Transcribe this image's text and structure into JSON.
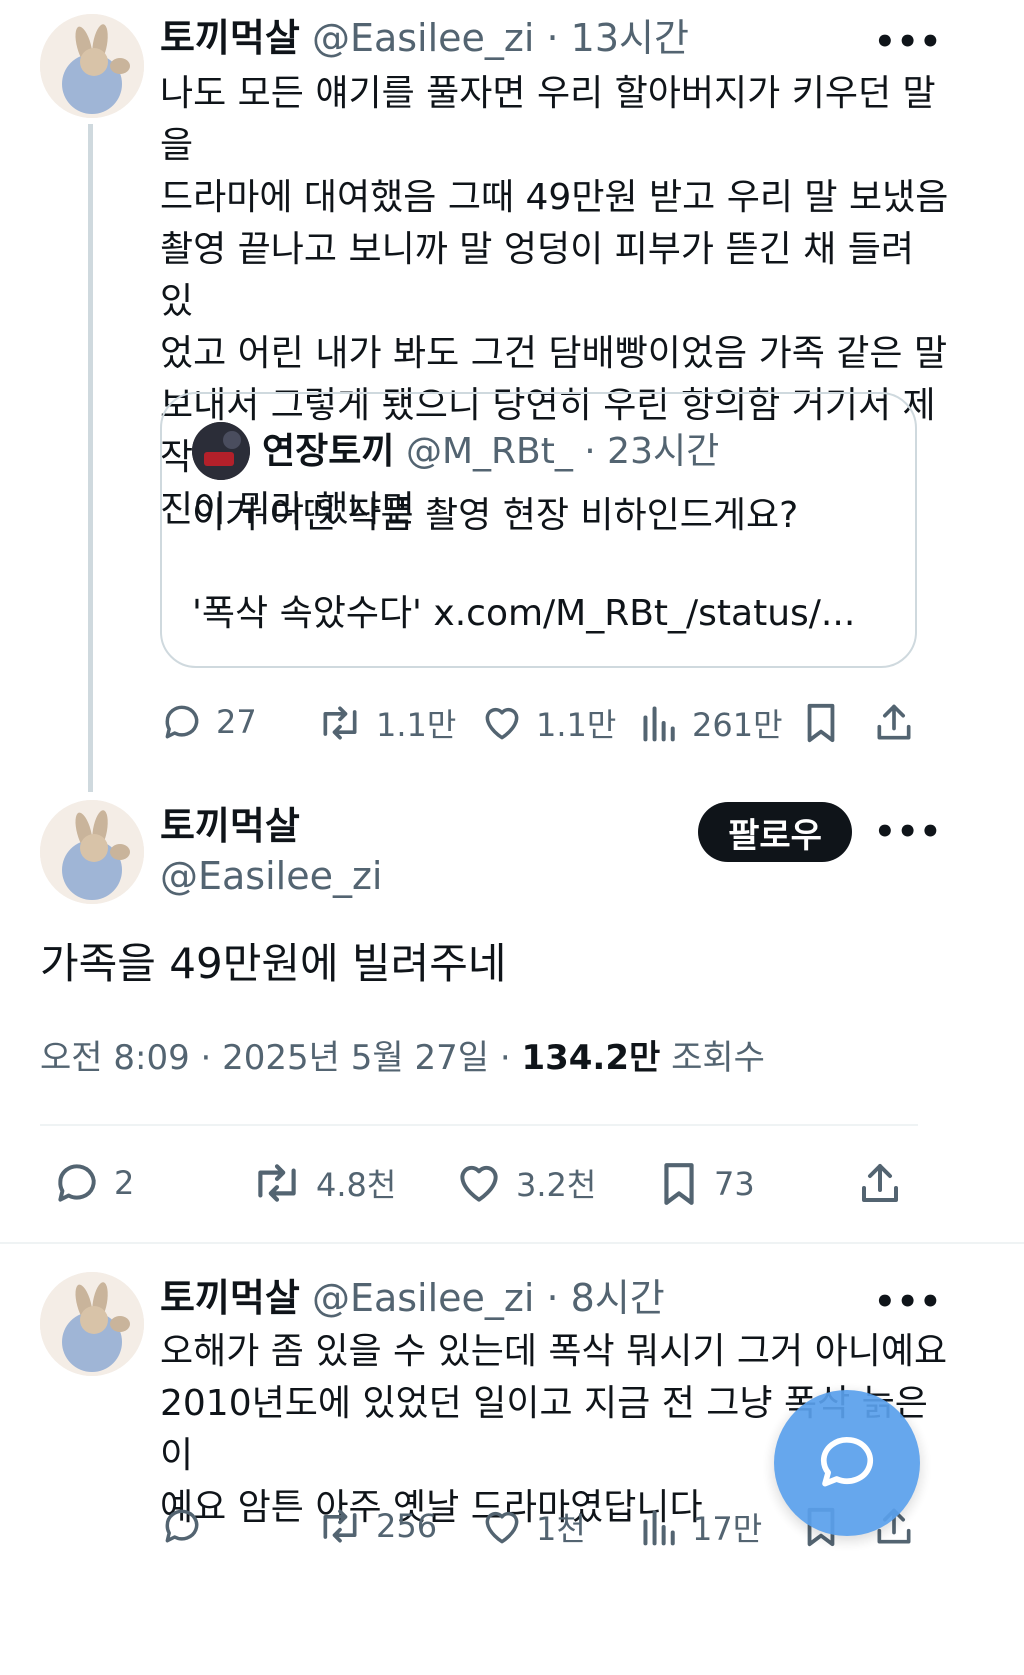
{
  "tweet1": {
    "display_name": "토끼먹살",
    "handle": "@Easilee_zi",
    "time": "· 13시간",
    "text": "나도 모든 얘기를 풀자면 우리 할아버지가 키우던 말을\n드라마에 대여했음 그때 49만원 받고 우리 말 보냈음\n촬영 끝나고 보니까 말 엉덩이 피부가 뜯긴 채 들려 있\n었고 어린 내가 봐도 그건 담배빵이었음 가족 같은 말\n보내서 그렇게 됐으니 당연히 우린 항의함 거기서 제작\n진이 뭐라 했냐면",
    "quote": {
      "display_name": "연장토끼",
      "handle": "@M_RBt_",
      "time": "· 23시간",
      "line1": "이거 어떤 작품 촬영 현장 비하인드게요?",
      "line2": "'폭삭 속았수다' x.com/M_RBt_/status/..."
    },
    "actions": {
      "replies": "27",
      "retweets": "1.1만",
      "likes": "1.1만",
      "views": "261만"
    }
  },
  "main": {
    "display_name": "토끼먹살",
    "handle": "@Easilee_zi",
    "follow_label": "팔로우",
    "text": "가족을 49만원에 빌려주네",
    "timestamp": "오전 8:09 · 2025년 5월 27일 · ",
    "views_count": "134.2만",
    "views_label": " 조회수",
    "actions": {
      "replies": "2",
      "retweets": "4.8천",
      "likes": "3.2천",
      "bookmarks": "73"
    }
  },
  "tweet3": {
    "display_name": "토끼먹살",
    "handle": "@Easilee_zi",
    "time": "· 8시간",
    "text": "오해가 좀 있을 수 있는데 폭삭 뭐시기 그거 아니예요\n2010년도에 있었던 일이고 지금 전 그냥 폭삭 늙은이\n예요 암튼 아주 옛날 드라마였답니다",
    "actions": {
      "replies": "",
      "retweets": "256",
      "likes": "1천",
      "views": "17만"
    }
  },
  "more_label": "•••",
  "colors": {
    "text": "#0f1419",
    "muted": "#536471",
    "border": "#cfd9de",
    "fab": "#5aa0ec",
    "follow_bg": "#0f1419"
  }
}
